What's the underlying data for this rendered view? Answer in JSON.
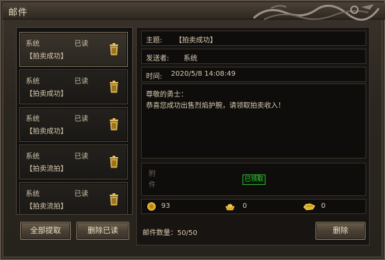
{
  "window": {
    "title": "邮件"
  },
  "mail_list": [
    {
      "sender": "系统",
      "status": "已读",
      "subject": "【拍卖成功】",
      "selected": true
    },
    {
      "sender": "系统",
      "status": "已读",
      "subject": "【拍卖成功】",
      "selected": false
    },
    {
      "sender": "系统",
      "status": "已读",
      "subject": "【拍卖成功】",
      "selected": false
    },
    {
      "sender": "系统",
      "status": "已读",
      "subject": "【拍卖流拍】",
      "selected": false
    },
    {
      "sender": "系统",
      "status": "已读",
      "subject": "【拍卖流拍】",
      "selected": false
    }
  ],
  "buttons": {
    "claim_all": "全部提取",
    "delete_read": "删除已读",
    "delete": "删除"
  },
  "detail": {
    "subject_label": "主题:",
    "subject_value": "【拍卖成功】",
    "sender_label": "发送者:",
    "sender_value": "系统",
    "time_label": "时间:",
    "time_value": "2020/5/8 14:08:49",
    "greeting": "尊敬的勇士：",
    "body": "恭喜您成功出售烈焰护腕，请领取拍卖收入！",
    "attachment_label": "附件",
    "claimed_badge": "已领取",
    "currencies": [
      {
        "icon": "gold-coin-icon",
        "value": "93"
      },
      {
        "icon": "gold-ingot-icon",
        "value": "0"
      },
      {
        "icon": "bound-ingot-icon",
        "value": "0"
      }
    ],
    "mail_count": "邮件数量：50/50"
  }
}
